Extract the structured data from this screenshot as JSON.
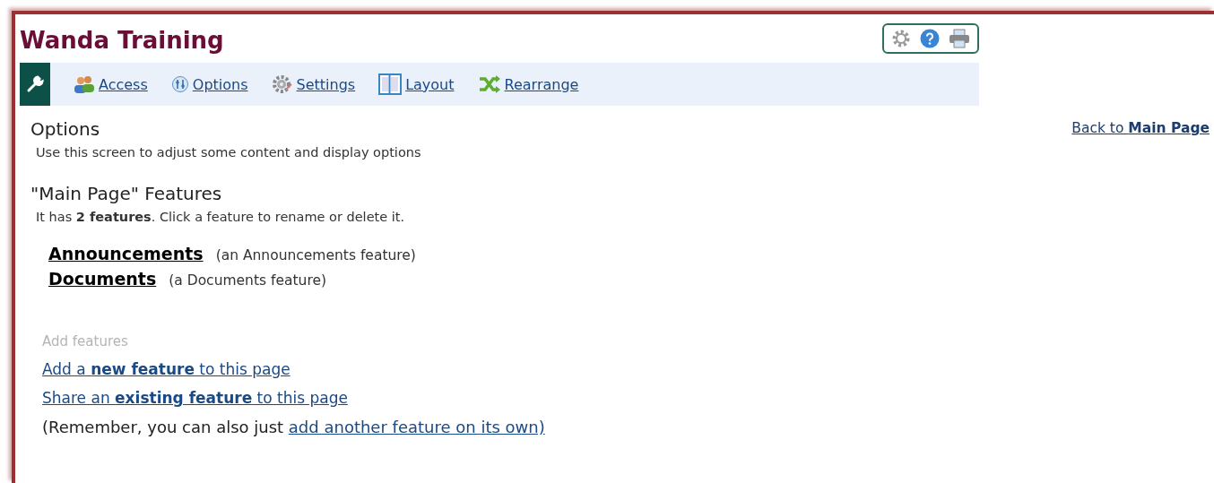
{
  "site_title": "Wanda Training",
  "toolbar": [
    {
      "kind": "access",
      "label": "Access"
    },
    {
      "kind": "options",
      "label": "Options"
    },
    {
      "kind": "settings",
      "label": "Settings"
    },
    {
      "kind": "layout",
      "label": "Layout"
    },
    {
      "kind": "rearrange",
      "label": "Rearrange"
    }
  ],
  "back_link": "Back to **Main Page**",
  "heading": "Options",
  "description": "Use this screen to adjust some content and display options",
  "features_heading": "\"Main Page\" Features",
  "features_summary": "It has **2 features**. Click a feature to rename or delete it.",
  "features": [
    {
      "name": "Announcements",
      "note": "(an Announcements feature)"
    },
    {
      "name": "Documents",
      "note": "(a Documents feature)"
    }
  ],
  "add_heading": "Add features",
  "add_links": [
    "Add a **new feature** to this page",
    "Share an **existing feature** to this page"
  ],
  "remember_text": "(Remember, you can also just ",
  "remember_link": "add another feature on its own)"
}
